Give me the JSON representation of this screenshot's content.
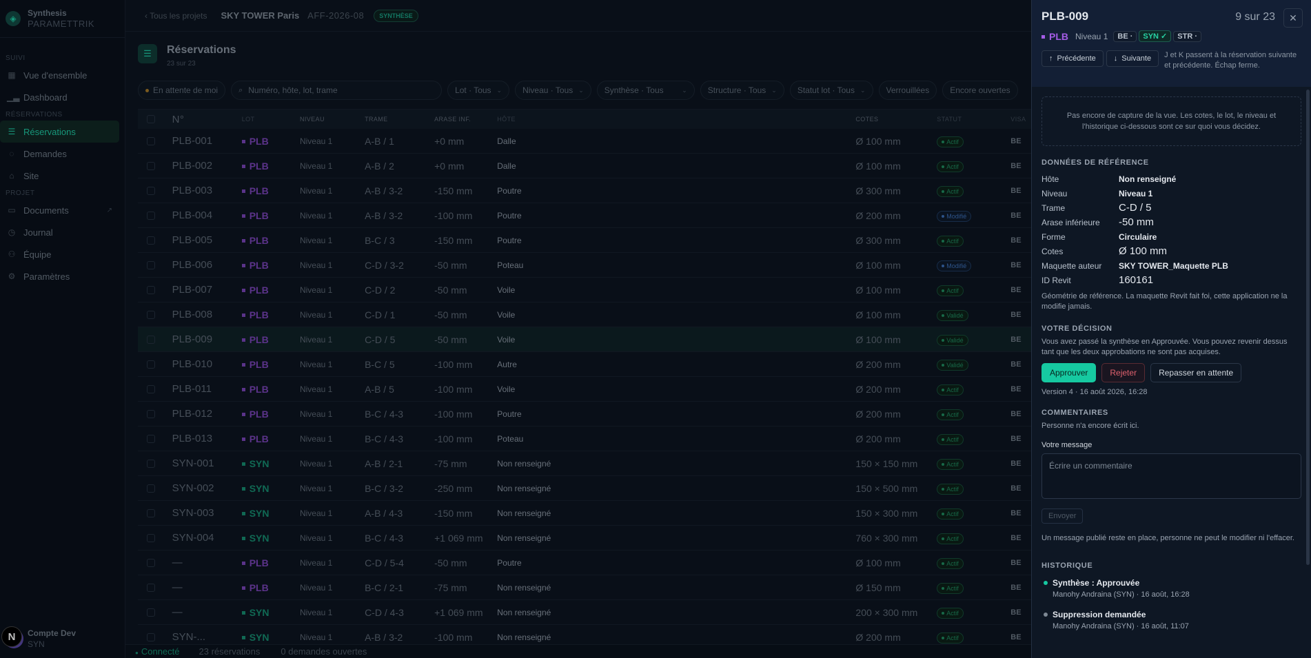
{
  "brand": {
    "name": "Synthesis",
    "sub": "PARAMETTRIK"
  },
  "sidebar": {
    "sections": [
      {
        "title": "SUIVI",
        "items": [
          {
            "label": "Vue d'ensemble",
            "icon": "grid-icon"
          },
          {
            "label": "Dashboard",
            "icon": "chart-icon"
          }
        ]
      },
      {
        "title": "RÉSERVATIONS",
        "items": [
          {
            "label": "Réservations",
            "icon": "list-icon",
            "active": true
          },
          {
            "label": "Demandes",
            "icon": "chat-icon"
          },
          {
            "label": "Site",
            "icon": "home-icon"
          }
        ]
      },
      {
        "title": "PROJET",
        "items": [
          {
            "label": "Documents",
            "icon": "folder-icon"
          },
          {
            "label": "Journal",
            "icon": "clock-icon"
          },
          {
            "label": "Équipe",
            "icon": "users-icon"
          },
          {
            "label": "Paramètres",
            "icon": "gear-icon"
          }
        ]
      }
    ],
    "user": {
      "name": "Compte Dev",
      "team": "SYN",
      "badge": "N"
    }
  },
  "topbar": {
    "back": "Tous les projets",
    "project": "SKY TOWER Paris",
    "code": "AFF-2026-08",
    "badge": "SYNTHÈSE"
  },
  "page": {
    "title": "Réservations",
    "subtitle": "23 sur 23"
  },
  "filters": {
    "pending": "En attente de moi",
    "search_placeholder": "Numéro, hôte, lot, trame",
    "selects": [
      "Lot · Tous",
      "Niveau · Tous",
      "Synthèse · Tous",
      "Structure · Tous",
      "Statut lot · Tous"
    ],
    "toggles": [
      "Verrouillées",
      "Encore ouvertes"
    ]
  },
  "table": {
    "headers": [
      "N°",
      "LOT",
      "NIVEAU",
      "TRAME",
      "ARASE INF.",
      "HÔTE",
      "COTES",
      "STATUT",
      "VISA"
    ],
    "rows": [
      {
        "num": "PLB-001",
        "lot": "PLB",
        "niveau": "Niveau 1",
        "trame": "A-B / 1",
        "arase": "+0 mm",
        "hote": "Dalle",
        "cotes": "Ø 100 mm",
        "statut": "Actif",
        "visa": "BE"
      },
      {
        "num": "PLB-002",
        "lot": "PLB",
        "niveau": "Niveau 1",
        "trame": "A-B / 2",
        "arase": "+0 mm",
        "hote": "Dalle",
        "cotes": "Ø 100 mm",
        "statut": "Actif",
        "visa": "BE"
      },
      {
        "num": "PLB-003",
        "lot": "PLB",
        "niveau": "Niveau 1",
        "trame": "A-B / 3-2",
        "arase": "-150 mm",
        "hote": "Poutre",
        "cotes": "Ø 300 mm",
        "statut": "Actif",
        "visa": "BE"
      },
      {
        "num": "PLB-004",
        "lot": "PLB",
        "niveau": "Niveau 1",
        "trame": "A-B / 3-2",
        "arase": "-100 mm",
        "hote": "Poutre",
        "cotes": "Ø 200 mm",
        "statut": "Modifié",
        "visa": "BE"
      },
      {
        "num": "PLB-005",
        "lot": "PLB",
        "niveau": "Niveau 1",
        "trame": "B-C / 3",
        "arase": "-150 mm",
        "hote": "Poutre",
        "cotes": "Ø 300 mm",
        "statut": "Actif",
        "visa": "BE"
      },
      {
        "num": "PLB-006",
        "lot": "PLB",
        "niveau": "Niveau 1",
        "trame": "C-D / 3-2",
        "arase": "-50 mm",
        "hote": "Poteau",
        "cotes": "Ø 100 mm",
        "statut": "Modifié",
        "visa": "BE"
      },
      {
        "num": "PLB-007",
        "lot": "PLB",
        "niveau": "Niveau 1",
        "trame": "C-D / 2",
        "arase": "-50 mm",
        "hote": "Voile",
        "cotes": "Ø 100 mm",
        "statut": "Actif",
        "visa": "BE"
      },
      {
        "num": "PLB-008",
        "lot": "PLB",
        "niveau": "Niveau 1",
        "trame": "C-D / 1",
        "arase": "-50 mm",
        "hote": "Voile",
        "cotes": "Ø 100 mm",
        "statut": "Validé",
        "visa": "BE"
      },
      {
        "num": "PLB-009",
        "lot": "PLB",
        "niveau": "Niveau 1",
        "trame": "C-D / 5",
        "arase": "-50 mm",
        "hote": "Voile",
        "cotes": "Ø 100 mm",
        "statut": "Validé",
        "visa": "BE",
        "selected": true
      },
      {
        "num": "PLB-010",
        "lot": "PLB",
        "niveau": "Niveau 1",
        "trame": "B-C / 5",
        "arase": "-100 mm",
        "hote": "Autre",
        "cotes": "Ø 200 mm",
        "statut": "Validé",
        "visa": "BE"
      },
      {
        "num": "PLB-011",
        "lot": "PLB",
        "niveau": "Niveau 1",
        "trame": "A-B / 5",
        "arase": "-100 mm",
        "hote": "Voile",
        "cotes": "Ø 200 mm",
        "statut": "Actif",
        "visa": "BE"
      },
      {
        "num": "PLB-012",
        "lot": "PLB",
        "niveau": "Niveau 1",
        "trame": "B-C / 4-3",
        "arase": "-100 mm",
        "hote": "Poutre",
        "cotes": "Ø 200 mm",
        "statut": "Actif",
        "visa": "BE"
      },
      {
        "num": "PLB-013",
        "lot": "PLB",
        "niveau": "Niveau 1",
        "trame": "B-C / 4-3",
        "arase": "-100 mm",
        "hote": "Poteau",
        "cotes": "Ø 200 mm",
        "statut": "Actif",
        "visa": "BE"
      },
      {
        "num": "SYN-001",
        "lot": "SYN",
        "niveau": "Niveau 1",
        "trame": "A-B / 2-1",
        "arase": "-75 mm",
        "hote": "Non renseigné",
        "cotes": "150 × 150 mm",
        "statut": "Actif",
        "visa": "BE"
      },
      {
        "num": "SYN-002",
        "lot": "SYN",
        "niveau": "Niveau 1",
        "trame": "B-C / 3-2",
        "arase": "-250 mm",
        "hote": "Non renseigné",
        "cotes": "150 × 500 mm",
        "statut": "Actif",
        "visa": "BE"
      },
      {
        "num": "SYN-003",
        "lot": "SYN",
        "niveau": "Niveau 1",
        "trame": "A-B / 4-3",
        "arase": "-150 mm",
        "hote": "Non renseigné",
        "cotes": "150 × 300 mm",
        "statut": "Actif",
        "visa": "BE"
      },
      {
        "num": "SYN-004",
        "lot": "SYN",
        "niveau": "Niveau 1",
        "trame": "B-C / 4-3",
        "arase": "+1 069 mm",
        "hote": "Non renseigné",
        "cotes": "760 × 300 mm",
        "statut": "Actif",
        "visa": "BE"
      },
      {
        "num": "—",
        "lot": "PLB",
        "niveau": "Niveau 1",
        "trame": "C-D / 5-4",
        "arase": "-50 mm",
        "hote": "Poutre",
        "cotes": "Ø 100 mm",
        "statut": "Actif",
        "visa": "BE"
      },
      {
        "num": "—",
        "lot": "PLB",
        "niveau": "Niveau 1",
        "trame": "B-C / 2-1",
        "arase": "-75 mm",
        "hote": "Non renseigné",
        "cotes": "Ø 150 mm",
        "statut": "Actif",
        "visa": "BE"
      },
      {
        "num": "—",
        "lot": "SYN",
        "niveau": "Niveau 1",
        "trame": "C-D / 4-3",
        "arase": "+1 069 mm",
        "hote": "Non renseigné",
        "cotes": "200 × 300 mm",
        "statut": "Actif",
        "visa": "BE"
      },
      {
        "num": "SYN-...",
        "lot": "SYN",
        "niveau": "Niveau 1",
        "trame": "A-B / 3-2",
        "arase": "-100 mm",
        "hote": "Non renseigné",
        "cotes": "Ø 200 mm",
        "statut": "Actif",
        "visa": "BE"
      }
    ]
  },
  "statusbar": {
    "connected": "Connecté",
    "count": "23 réservations",
    "open": "0 demandes ouvertes"
  },
  "panel": {
    "title": "PLB-009",
    "position": "9 sur 23",
    "lot": "PLB",
    "niveau": "Niveau 1",
    "tags": [
      "BE ·",
      "SYN ✓",
      "STR ·"
    ],
    "prev": "Précédente",
    "next": "Suivante",
    "hint": "J et K passent à la réservation suivante et précédente. Échap ferme.",
    "capture": "Pas encore de capture de la vue. Les cotes, le lot, le niveau et l'historique ci-dessous sont ce sur quoi vous décidez.",
    "ref_title": "DONNÉES DE RÉFÉRENCE",
    "ref": [
      {
        "k": "Hôte",
        "v": "Non renseigné"
      },
      {
        "k": "Niveau",
        "v": "Niveau 1"
      },
      {
        "k": "Trame",
        "v": "C-D / 5",
        "big": true
      },
      {
        "k": "Arase inférieure",
        "v": "-50 mm",
        "big": true
      },
      {
        "k": "Forme",
        "v": "Circulaire"
      },
      {
        "k": "Cotes",
        "v": "Ø 100 mm",
        "big": true
      },
      {
        "k": "Maquette auteur",
        "v": "SKY TOWER_Maquette PLB"
      },
      {
        "k": "ID Revit",
        "v": "160161",
        "big": true
      }
    ],
    "ref_note": "Géométrie de référence. La maquette Revit fait foi, cette application ne la modifie jamais.",
    "decision_title": "VOTRE DÉCISION",
    "decision_text": "Vous avez passé la synthèse en Approuvée. Vous pouvez revenir dessus tant que les deux approbations ne sont pas acquises.",
    "approve": "Approuver",
    "reject": "Rejeter",
    "reset": "Repasser en attente",
    "version": "Version 4 · 16 août 2026, 16:28",
    "comments_title": "COMMENTAIRES",
    "comments_empty": "Personne n'a encore écrit ici.",
    "message_label": "Votre message",
    "message_placeholder": "Écrire un commentaire",
    "send": "Envoyer",
    "message_note": "Un message publié reste en place, personne ne peut le modifier ni l'effacer.",
    "history_title": "HISTORIQUE",
    "history": [
      {
        "title": "Synthèse : Approuvée",
        "sub": "Manohy Andraina (SYN) · 16 août, 16:28"
      },
      {
        "title": "Suppression demandée",
        "sub": "Manohy Andraina (SYN) · 16 août, 11:07"
      }
    ]
  }
}
